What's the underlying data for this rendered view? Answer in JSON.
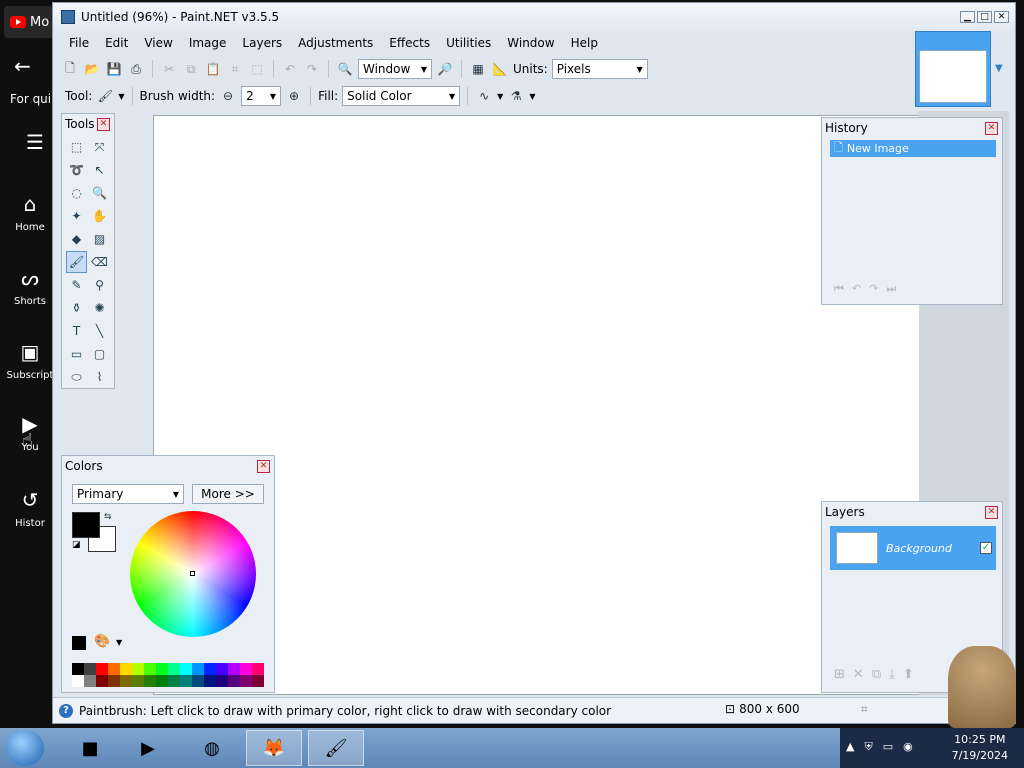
{
  "window": {
    "title": "Untitled (96%) - Paint.NET v3.5.5"
  },
  "background": {
    "logo_text": "Mo",
    "tooltip": "For qui",
    "nav": [
      "Home",
      "Shorts",
      "Subscript",
      "You",
      "Histor"
    ]
  },
  "menu": [
    "File",
    "Edit",
    "View",
    "Image",
    "Layers",
    "Adjustments",
    "Effects",
    "Utilities",
    "Window",
    "Help"
  ],
  "toolbar": {
    "zoom_value": "Window",
    "units_label": "Units:",
    "units_value": "Pixels",
    "tool_label": "Tool:",
    "brush_label": "Brush width:",
    "brush_value": "2",
    "fill_label": "Fill:",
    "fill_value": "Solid Color"
  },
  "tools_panel": {
    "title": "Tools"
  },
  "history_panel": {
    "title": "History",
    "item": "New Image"
  },
  "layers_panel": {
    "title": "Layers",
    "layer": "Background"
  },
  "colors_panel": {
    "title": "Colors",
    "mode": "Primary",
    "more": "More >>"
  },
  "status": {
    "text": "Paintbrush: Left click to draw with primary color, right click to draw with secondary color",
    "size": "800 x 600"
  },
  "taskbar": {
    "time": "10:25 PM",
    "date": "7/19/2024"
  },
  "palette": [
    "#000000",
    "#404040",
    "#ff0000",
    "#ff6a00",
    "#ffd800",
    "#b6ff00",
    "#4cff00",
    "#00ff21",
    "#00ff90",
    "#00ffff",
    "#0094ff",
    "#0026ff",
    "#4800ff",
    "#b200ff",
    "#ff00dc",
    "#ff006e",
    "#ffffff",
    "#808080",
    "#7f0000",
    "#7f3300",
    "#7f6a00",
    "#5b7f00",
    "#267f00",
    "#007f0e",
    "#007f46",
    "#007f7f",
    "#004a7f",
    "#00137f",
    "#21007f",
    "#57007f",
    "#7f006e",
    "#7f0037"
  ]
}
